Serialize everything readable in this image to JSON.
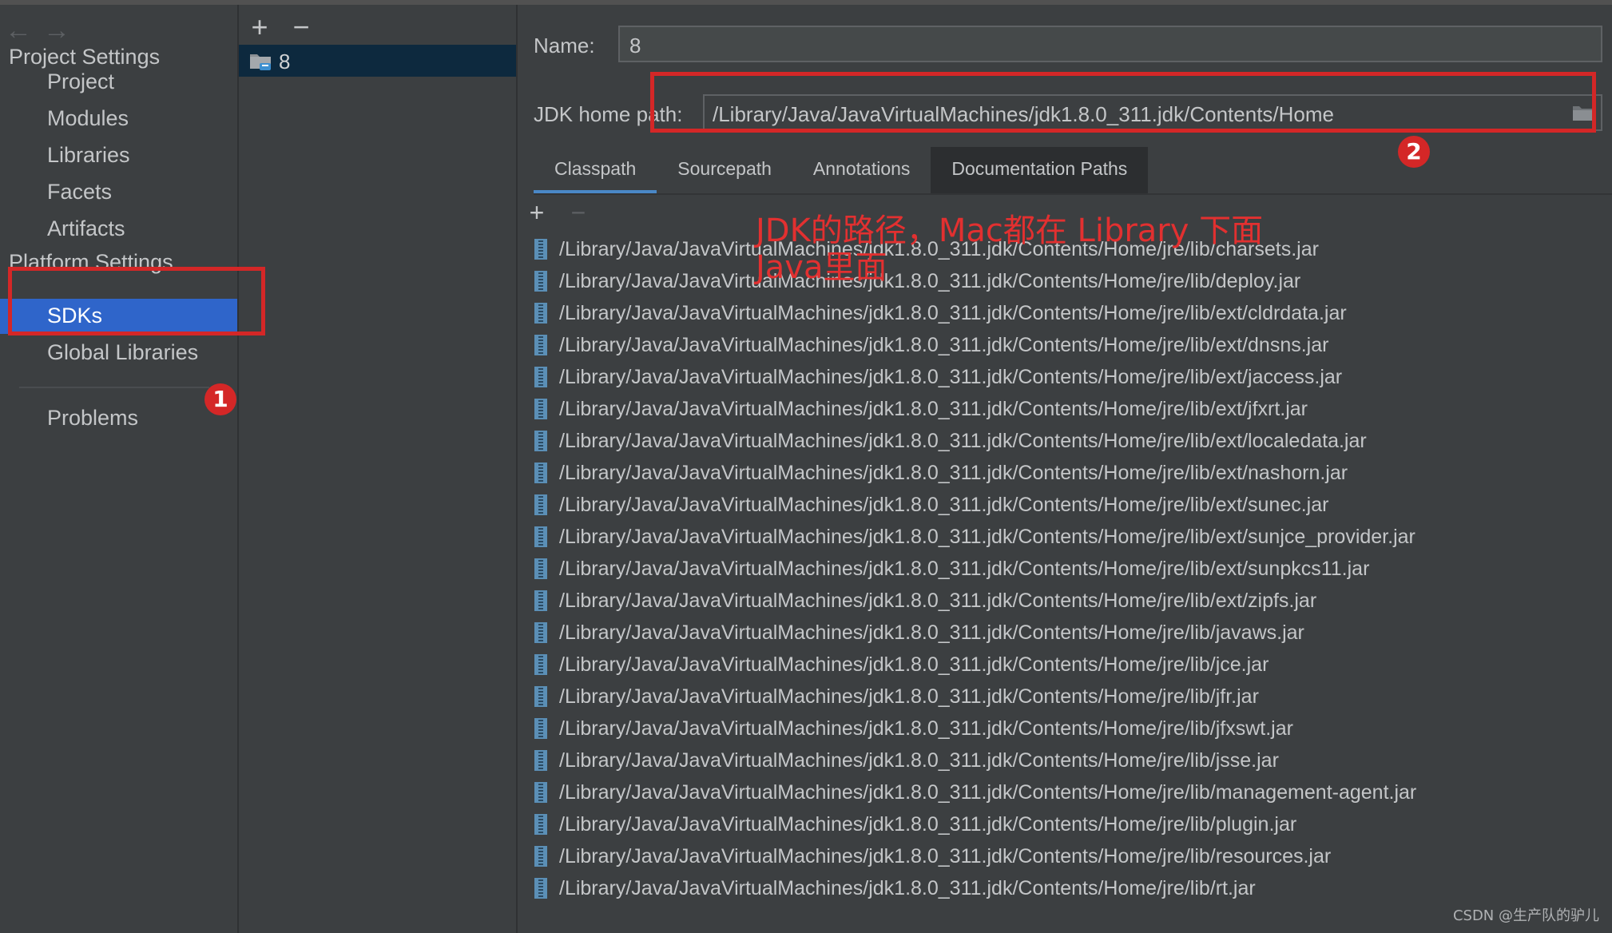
{
  "navigation": {
    "back_icon": "arrow-left-icon",
    "forward_icon": "arrow-right-icon",
    "back_glyph": "←",
    "forward_glyph": "→"
  },
  "sidebar": {
    "project_settings_header": "Project Settings",
    "project_items": [
      "Project",
      "Modules",
      "Libraries",
      "Facets",
      "Artifacts"
    ],
    "platform_settings_header": "Platform Settings",
    "selected_item": "SDKs",
    "global_libraries": "Global Libraries",
    "problems": "Problems"
  },
  "sdk_list": {
    "add_glyph": "+",
    "remove_glyph": "−",
    "items": [
      {
        "label": "8",
        "icon": "jdk-folder-icon"
      }
    ]
  },
  "detail": {
    "name_label": "Name:",
    "name_value": "8",
    "jdk_home_label": "JDK home path:",
    "jdk_home_value": "/Library/Java/JavaVirtualMachines/jdk1.8.0_311.jdk/Contents/Home",
    "tabs": [
      {
        "label": "Classpath",
        "underlined": true,
        "selected": false
      },
      {
        "label": "Sourcepath",
        "underlined": false,
        "selected": false
      },
      {
        "label": "Annotations",
        "underlined": false,
        "selected": false
      },
      {
        "label": "Documentation Paths",
        "underlined": false,
        "selected": true
      }
    ],
    "list_add_glyph": "+",
    "list_remove_glyph": "−",
    "paths": [
      "/Library/Java/JavaVirtualMachines/jdk1.8.0_311.jdk/Contents/Home/jre/lib/charsets.jar",
      "/Library/Java/JavaVirtualMachines/jdk1.8.0_311.jdk/Contents/Home/jre/lib/deploy.jar",
      "/Library/Java/JavaVirtualMachines/jdk1.8.0_311.jdk/Contents/Home/jre/lib/ext/cldrdata.jar",
      "/Library/Java/JavaVirtualMachines/jdk1.8.0_311.jdk/Contents/Home/jre/lib/ext/dnsns.jar",
      "/Library/Java/JavaVirtualMachines/jdk1.8.0_311.jdk/Contents/Home/jre/lib/ext/jaccess.jar",
      "/Library/Java/JavaVirtualMachines/jdk1.8.0_311.jdk/Contents/Home/jre/lib/ext/jfxrt.jar",
      "/Library/Java/JavaVirtualMachines/jdk1.8.0_311.jdk/Contents/Home/jre/lib/ext/localedata.jar",
      "/Library/Java/JavaVirtualMachines/jdk1.8.0_311.jdk/Contents/Home/jre/lib/ext/nashorn.jar",
      "/Library/Java/JavaVirtualMachines/jdk1.8.0_311.jdk/Contents/Home/jre/lib/ext/sunec.jar",
      "/Library/Java/JavaVirtualMachines/jdk1.8.0_311.jdk/Contents/Home/jre/lib/ext/sunjce_provider.jar",
      "/Library/Java/JavaVirtualMachines/jdk1.8.0_311.jdk/Contents/Home/jre/lib/ext/sunpkcs11.jar",
      "/Library/Java/JavaVirtualMachines/jdk1.8.0_311.jdk/Contents/Home/jre/lib/ext/zipfs.jar",
      "/Library/Java/JavaVirtualMachines/jdk1.8.0_311.jdk/Contents/Home/jre/lib/javaws.jar",
      "/Library/Java/JavaVirtualMachines/jdk1.8.0_311.jdk/Contents/Home/jre/lib/jce.jar",
      "/Library/Java/JavaVirtualMachines/jdk1.8.0_311.jdk/Contents/Home/jre/lib/jfr.jar",
      "/Library/Java/JavaVirtualMachines/jdk1.8.0_311.jdk/Contents/Home/jre/lib/jfxswt.jar",
      "/Library/Java/JavaVirtualMachines/jdk1.8.0_311.jdk/Contents/Home/jre/lib/jsse.jar",
      "/Library/Java/JavaVirtualMachines/jdk1.8.0_311.jdk/Contents/Home/jre/lib/management-agent.jar",
      "/Library/Java/JavaVirtualMachines/jdk1.8.0_311.jdk/Contents/Home/jre/lib/plugin.jar",
      "/Library/Java/JavaVirtualMachines/jdk1.8.0_311.jdk/Contents/Home/jre/lib/resources.jar",
      "/Library/Java/JavaVirtualMachines/jdk1.8.0_311.jdk/Contents/Home/jre/lib/rt.jar"
    ]
  },
  "annotations": {
    "badge_1": "1",
    "badge_2": "2",
    "note_line1": "JDK的路径，Mac都在 Library 下面",
    "note_line2": "Java里面",
    "color": "#d42727"
  },
  "watermark": "CSDN @生产队的驴儿",
  "colors": {
    "background": "#3c3f41",
    "selection": "#2f65ca",
    "list_selection": "#0d293e",
    "tab_underline": "#4a88c7",
    "jar_icon": "#5b8fb6"
  }
}
